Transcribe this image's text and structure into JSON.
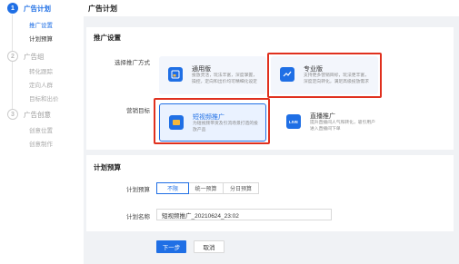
{
  "steps": [
    {
      "num": "1",
      "title": "广告计划",
      "subs": [
        "推广设置",
        "计划预算"
      ]
    },
    {
      "num": "2",
      "title": "广告组",
      "subs": [
        "转化跟踪",
        "定向人群",
        "目标和出价"
      ]
    },
    {
      "num": "3",
      "title": "广告创意",
      "subs": [
        "创意位置",
        "创意制作"
      ]
    }
  ],
  "header": {
    "title": "广告计划"
  },
  "promo": {
    "section_title": "推广设置",
    "method_label": "选择推广方式",
    "goal_label": "营销目标",
    "cards": [
      {
        "title": "通用版",
        "desc": "投放灵活，玩法丰富，深度掌握，操控，定向和出价均可精细化设定"
      },
      {
        "title": "专业版",
        "desc": "支持更多营销目标，玩法更丰富，深度定向转化，满足高级投放需求"
      },
      {
        "title": "短视频推广",
        "desc": "为短视频带货及引流场景打造的投放产品"
      },
      {
        "title": "直播推广",
        "desc": "提升直播间人气和转化，吸引用户进入直播间下单"
      }
    ],
    "live_badge": "LIVE"
  },
  "budget": {
    "section_title": "计划预算",
    "budget_label": "计划预算",
    "options": [
      "不限",
      "统一预算",
      "分日预算"
    ],
    "name_label": "计划名称",
    "name_value": "短视频推广_20210624_23:02"
  },
  "footer": {
    "next": "下一步",
    "cancel": "取消"
  },
  "colors": {
    "accent": "#1f6fe5",
    "highlight": "#e0301e"
  }
}
